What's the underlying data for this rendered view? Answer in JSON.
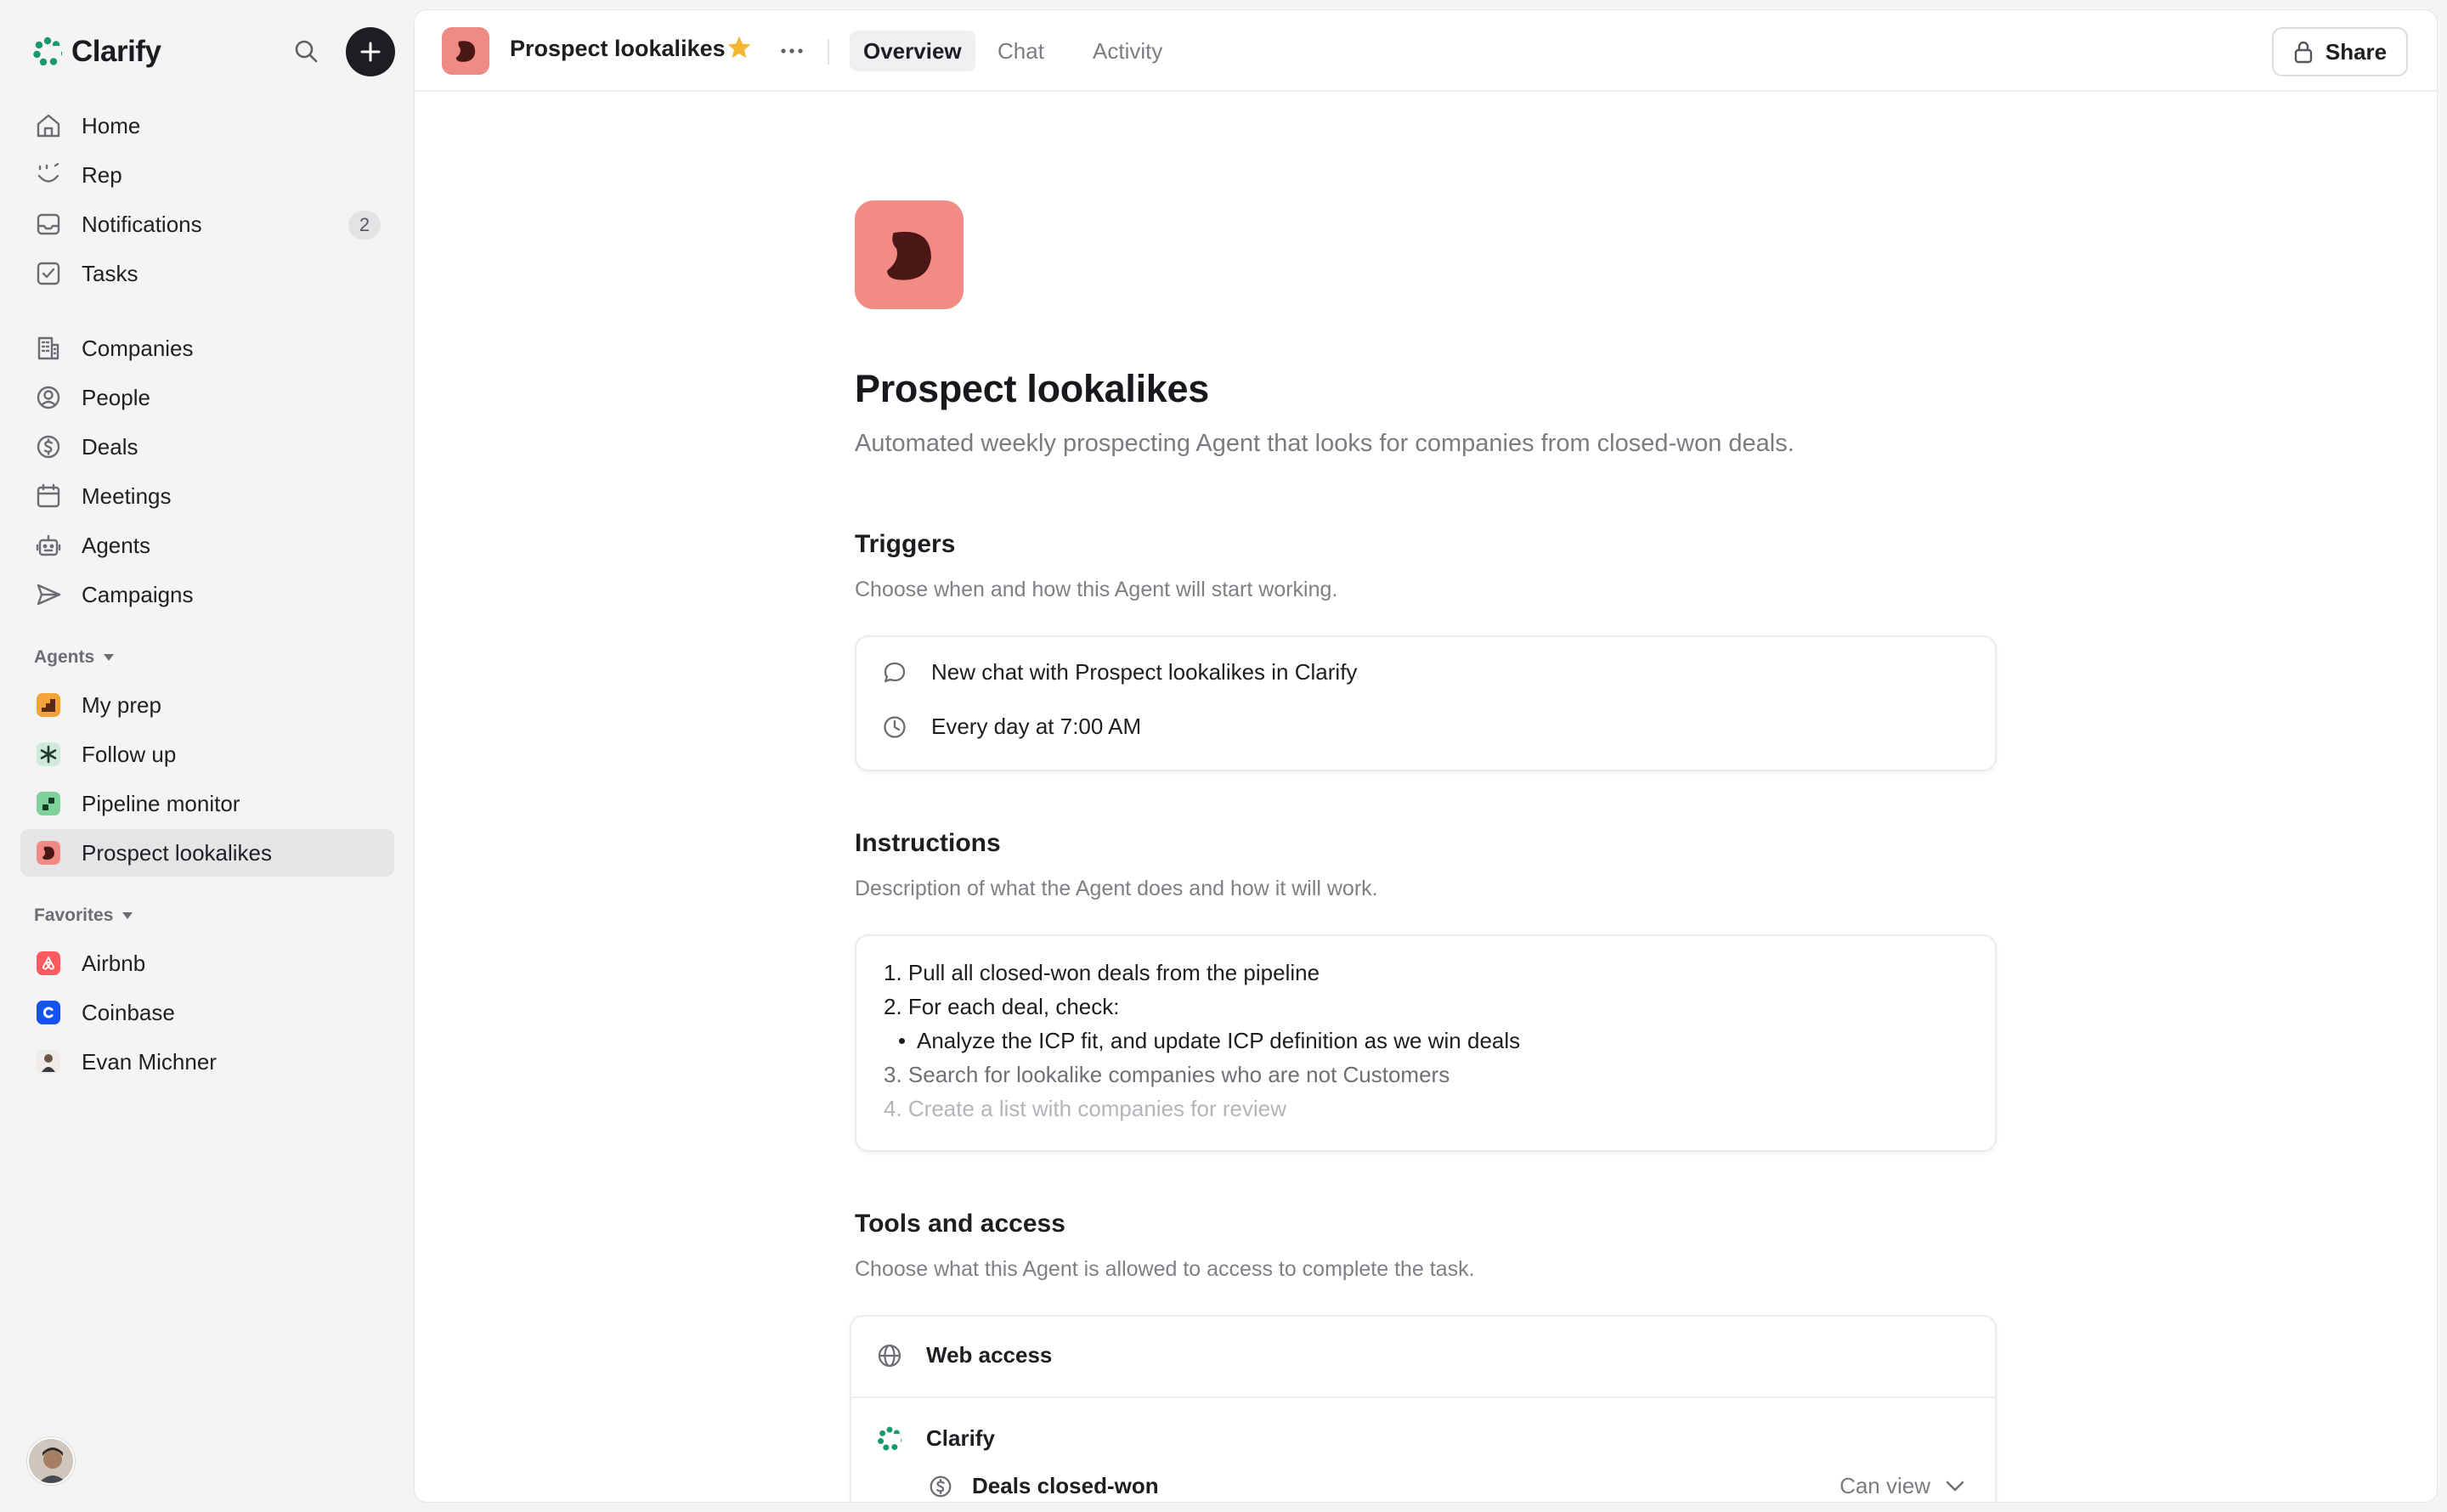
{
  "brand": {
    "name": "Clarify",
    "color": "#1a9a6a"
  },
  "sidebar": {
    "primary": [
      {
        "label": "Home",
        "icon": "home-icon"
      },
      {
        "label": "Rep",
        "icon": "rep-icon"
      },
      {
        "label": "Notifications",
        "icon": "inbox-icon",
        "badge": "2"
      },
      {
        "label": "Tasks",
        "icon": "checkbox-icon"
      }
    ],
    "records": [
      {
        "label": "Companies",
        "icon": "building-icon"
      },
      {
        "label": "People",
        "icon": "person-icon"
      },
      {
        "label": "Deals",
        "icon": "dollar-icon"
      },
      {
        "label": "Meetings",
        "icon": "calendar-icon"
      },
      {
        "label": "Agents",
        "icon": "robot-icon"
      },
      {
        "label": "Campaigns",
        "icon": "send-icon"
      }
    ],
    "agents_label": "Agents",
    "agents": [
      {
        "label": "My prep",
        "color": "#f3a33a"
      },
      {
        "label": "Follow up",
        "color": "#cfe9dc"
      },
      {
        "label": "Pipeline monitor",
        "color": "#7fd19b"
      },
      {
        "label": "Prospect lookalikes",
        "color": "#f08a84",
        "active": true
      }
    ],
    "favorites_label": "Favorites",
    "favorites": [
      {
        "label": "Airbnb",
        "color": "#ff5a5f"
      },
      {
        "label": "Coinbase",
        "color": "#1652f0"
      },
      {
        "label": "Evan Michner",
        "color": "#b9b1a8"
      }
    ]
  },
  "topbar": {
    "title": "Prospect lookalikes",
    "star_color": "#f2b632",
    "tabs": [
      "Overview",
      "Chat",
      "Activity"
    ],
    "active_tab": "Overview",
    "share_label": "Share"
  },
  "agent": {
    "title": "Prospect lookalikes",
    "description": "Automated weekly prospecting Agent that looks for companies from closed-won deals.",
    "accent_color": "#f38b85"
  },
  "triggers": {
    "title": "Triggers",
    "description": "Choose when and how this Agent will start working.",
    "items": [
      {
        "icon": "chat-bubble-icon",
        "label": "New chat with Prospect lookalikes in Clarify"
      },
      {
        "icon": "clock-icon",
        "label": "Every day at 7:00 AM"
      }
    ]
  },
  "instructions": {
    "title": "Instructions",
    "description": "Description of what the Agent does and how it will work.",
    "lines": [
      "1. Pull all closed-won deals from the pipeline",
      "2. For each deal, check:",
      "Analyze the ICP fit, and update ICP definition as we win deals",
      "3. Search for lookalike companies who are not Customers",
      "4. Create a list with companies for review"
    ]
  },
  "tools": {
    "title": "Tools and access",
    "description": "Choose what this Agent is allowed to access to complete the task.",
    "web_access": "Web access",
    "clarify": "Clarify",
    "permission": {
      "label": "Deals closed-won",
      "value": "Can view"
    }
  }
}
